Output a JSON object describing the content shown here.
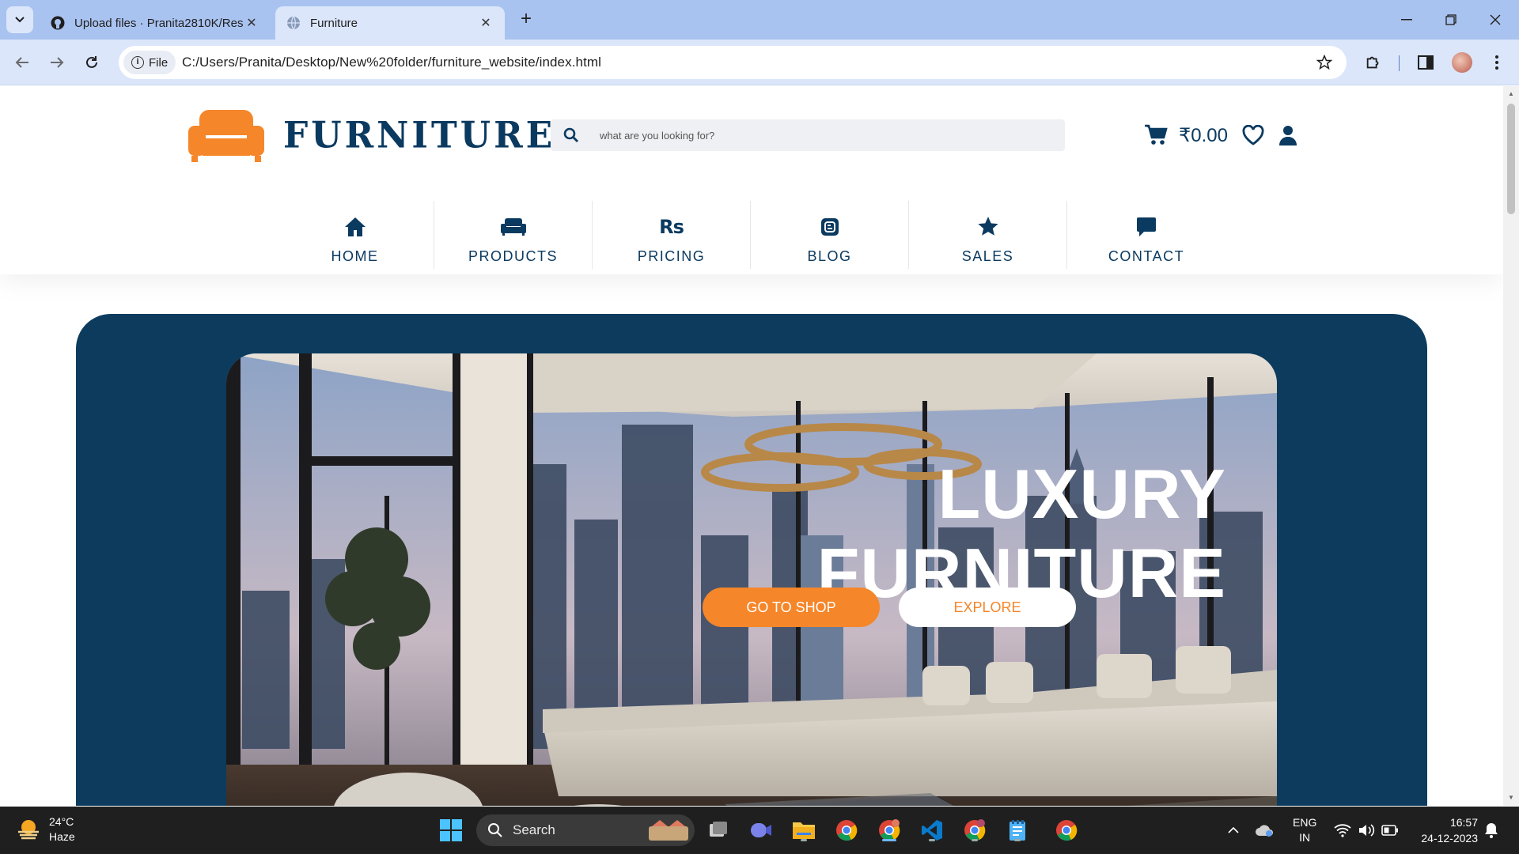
{
  "browser": {
    "tabs": [
      {
        "title": "Upload files · Pranita2810K/Res",
        "active": false,
        "icon": "github-icon"
      },
      {
        "title": "Furniture",
        "active": true,
        "icon": "globe-icon"
      }
    ],
    "address_chip": "File",
    "url": "C:/Users/Pranita/Desktop/New%20folder/furniture_website/index.html"
  },
  "header": {
    "logo_text": "FURNITURE",
    "search_placeholder": "what are you looking for?",
    "cart_total": "₹0.00"
  },
  "nav": {
    "items": [
      {
        "label": "HOME",
        "icon": "home-icon"
      },
      {
        "label": "PRODUCTS",
        "icon": "sofa-icon"
      },
      {
        "label": "PRICING",
        "icon": "rupee-icon"
      },
      {
        "label": "BLOG",
        "icon": "blog-icon"
      },
      {
        "label": "SALES",
        "icon": "star-icon"
      },
      {
        "label": "CONTACT",
        "icon": "chat-icon"
      }
    ],
    "pricing_glyph": "Rs"
  },
  "hero": {
    "title_line1": "LUXURY",
    "title_line2": "FURNITURE",
    "primary_button": "GO TO SHOP",
    "secondary_button": "EXPLORE"
  },
  "taskbar": {
    "weather_temp": "24°C",
    "weather_desc": "Haze",
    "search_label": "Search",
    "lang_line1": "ENG",
    "lang_line2": "IN",
    "time": "16:57",
    "date": "24-12-2023"
  },
  "colors": {
    "brand_navy": "#0b3a60",
    "hero_bg": "#0c3b5d",
    "accent_orange": "#f5862a",
    "browser_frame": "#a9c3f0"
  }
}
